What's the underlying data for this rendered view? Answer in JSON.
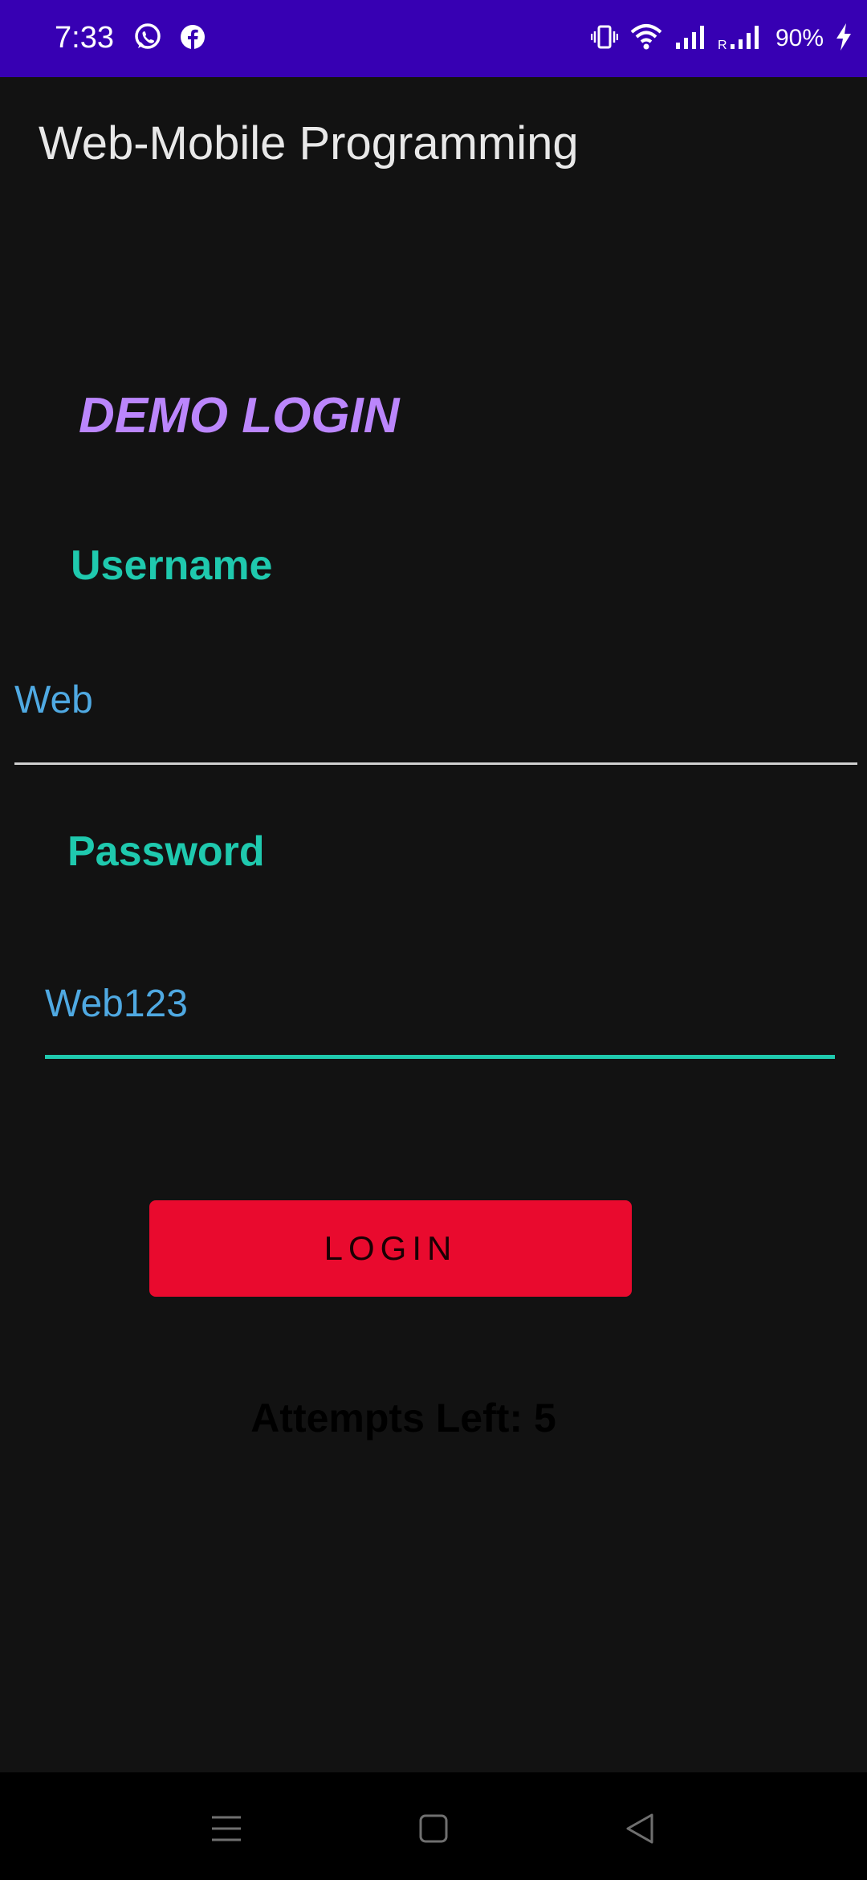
{
  "status_bar": {
    "time": "7:33",
    "battery": "90%",
    "left_icons": [
      "whatsapp-icon",
      "facebook-icon"
    ],
    "right_icons": [
      "vibrate-icon",
      "wifi-icon",
      "signal-icon",
      "roaming-signal-icon",
      "charging-icon"
    ]
  },
  "app_bar": {
    "title": "Web-Mobile Programming"
  },
  "form": {
    "heading": "DEMO LOGIN",
    "username_label": "Username",
    "username_value": "Web",
    "password_label": "Password",
    "password_value": "Web123",
    "login_button": "LOGIN",
    "attempts_text": "Attempts Left: 5"
  },
  "nav_bar": {
    "icons": [
      "menu-icon",
      "home-icon",
      "back-icon"
    ]
  },
  "colors": {
    "status_bar": "#3700B3",
    "background": "#121212",
    "heading": "#BB86FC",
    "label": "#1FC9AE",
    "field_text": "#4FA9E2",
    "button": "#E90A2E"
  }
}
